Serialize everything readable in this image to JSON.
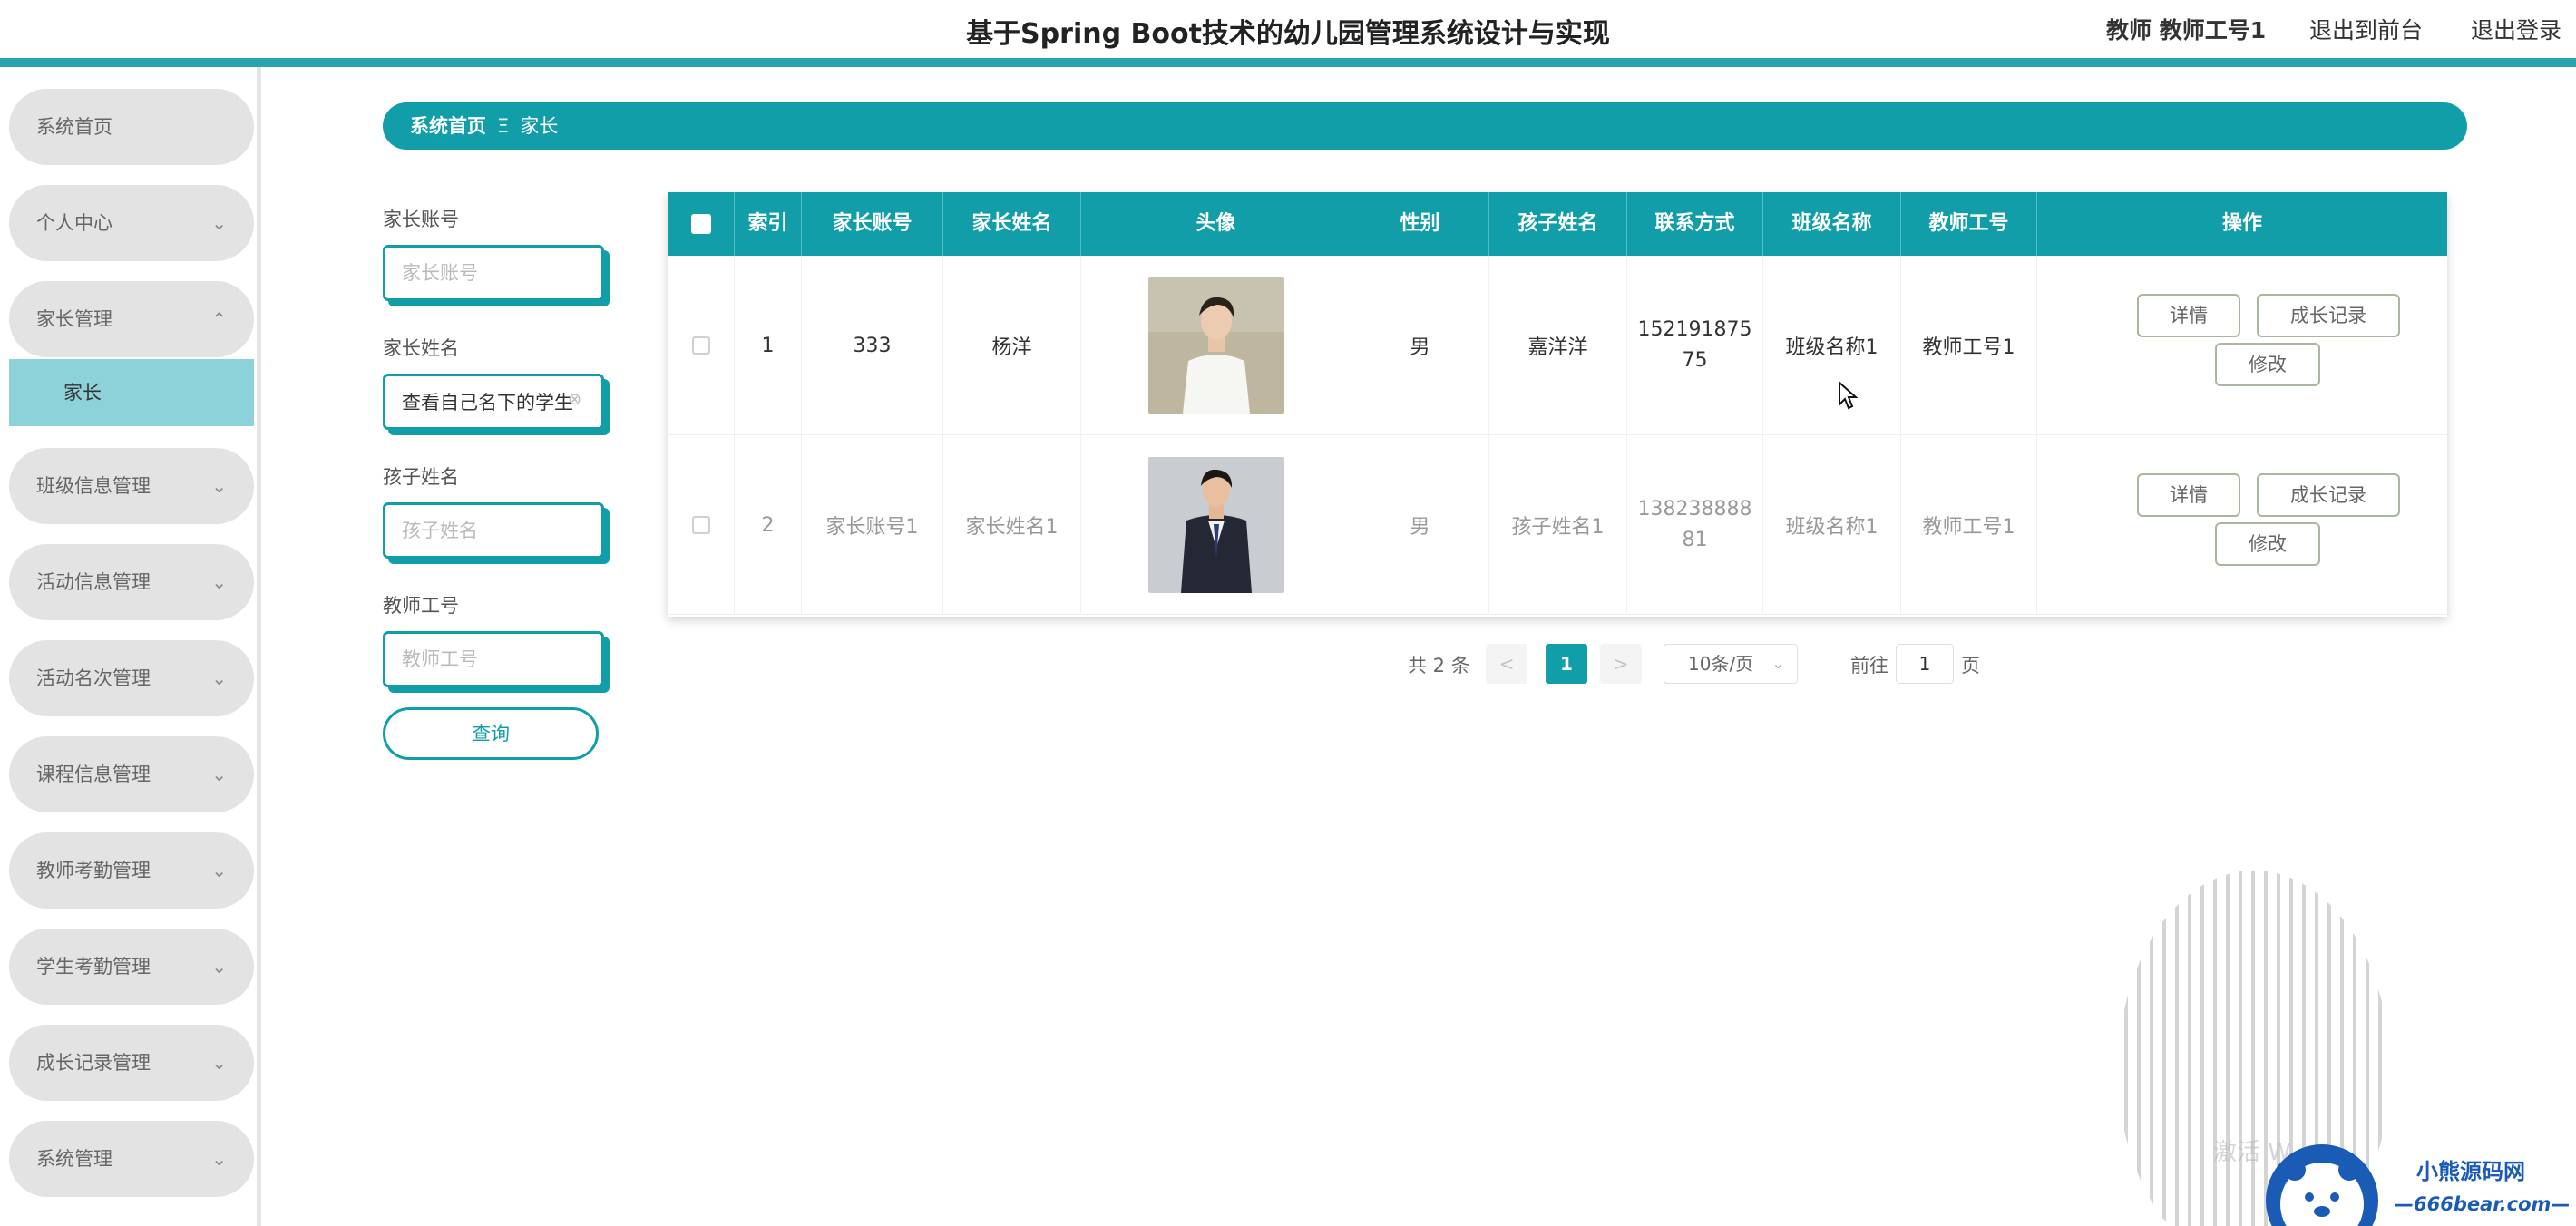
{
  "header": {
    "title": "基于Spring Boot技术的幼儿园管理系统设计与实现",
    "user": "教师 教师工号1",
    "back_front": "退出到前台",
    "logout": "退出登录"
  },
  "sidebar": {
    "items": [
      {
        "label": "系统首页",
        "expandable": false
      },
      {
        "label": "个人中心",
        "expandable": true
      },
      {
        "label": "家长管理",
        "expandable": true,
        "expanded": true
      },
      {
        "label": "班级信息管理",
        "expandable": true
      },
      {
        "label": "活动信息管理",
        "expandable": true
      },
      {
        "label": "活动名次管理",
        "expandable": true
      },
      {
        "label": "课程信息管理",
        "expandable": true
      },
      {
        "label": "教师考勤管理",
        "expandable": true
      },
      {
        "label": "学生考勤管理",
        "expandable": true
      },
      {
        "label": "成长记录管理",
        "expandable": true
      },
      {
        "label": "系统管理",
        "expandable": true
      }
    ],
    "active_sub": "家长",
    "chevron_down": "⌄",
    "chevron_up": "⌃"
  },
  "breadcrumb": {
    "home": "系统首页",
    "separator": "Ξ",
    "current": "家长"
  },
  "filters": {
    "account": {
      "label": "家长账号",
      "placeholder": "家长账号",
      "value": ""
    },
    "name": {
      "label": "家长姓名",
      "placeholder": "家长姓名",
      "value": "查看自己名下的学生"
    },
    "child": {
      "label": "孩子姓名",
      "placeholder": "孩子姓名",
      "value": ""
    },
    "teacher": {
      "label": "教师工号",
      "placeholder": "教师工号",
      "value": ""
    },
    "query_button": "查询"
  },
  "table": {
    "headers": [
      "索引",
      "家长账号",
      "家长姓名",
      "头像",
      "性别",
      "孩子姓名",
      "联系方式",
      "班级名称",
      "教师工号",
      "操作"
    ],
    "rows": [
      {
        "index": "1",
        "account": "333",
        "name": "杨洋",
        "gender": "男",
        "child": "嘉洋洋",
        "phone": [
          "152191875",
          "75"
        ],
        "class": "班级名称1",
        "teacher": "教师工号1"
      },
      {
        "index": "2",
        "account": "家长账号1",
        "name": "家长姓名1",
        "gender": "男",
        "child": "孩子姓名1",
        "phone": [
          "138238888",
          "81"
        ],
        "class": "班级名称1",
        "teacher": "教师工号1"
      }
    ],
    "actions": {
      "detail": "详情",
      "growth": "成长记录",
      "edit": "修改"
    }
  },
  "pagination": {
    "total": "共 2 条",
    "prev": "<",
    "current": "1",
    "next": ">",
    "page_size": "10条/页",
    "goto_label": "前往",
    "goto_value": "1",
    "page_label": "页"
  },
  "branding": {
    "watermark": "激活 W",
    "logo_name": "小熊源码网",
    "logo_url": "—666bear.com—"
  },
  "colors": {
    "accent": "#129ea8",
    "topbar_accent": "#26a5ad",
    "submenu_active": "#8dd2d8",
    "sidebar_item": "#e3e3e3"
  }
}
